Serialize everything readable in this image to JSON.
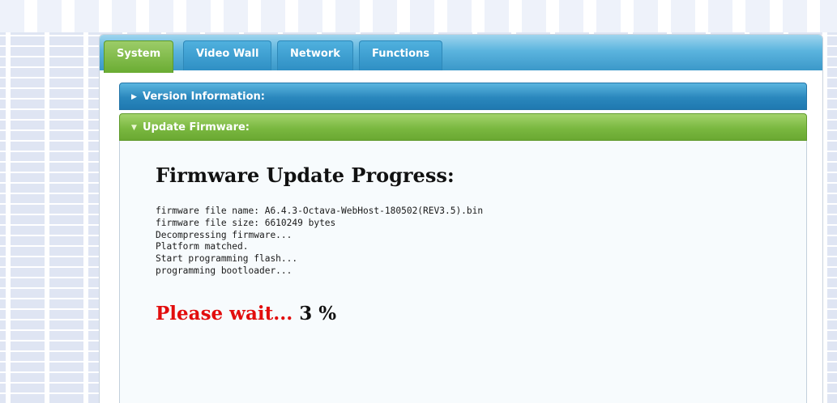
{
  "tabs": [
    {
      "label": "System",
      "active": true
    },
    {
      "label": "Video Wall",
      "active": false
    },
    {
      "label": "Network",
      "active": false
    },
    {
      "label": "Functions",
      "active": false
    }
  ],
  "sections": {
    "version_info": {
      "label": "Version Information:",
      "expanded": false,
      "icon": "caret-right-icon"
    },
    "update_firmware": {
      "label": "Update Firmware:",
      "expanded": true,
      "icon": "caret-down-icon"
    }
  },
  "firmware": {
    "heading": "Firmware Update Progress:",
    "log": [
      "firmware file name: A6.4.3-Octava-WebHost-180502(REV3.5).bin",
      "firmware file size: 6610249 bytes",
      "Decompressing firmware...",
      "Platform matched.",
      "Start programming flash...",
      "programming bootloader..."
    ],
    "wait_text": "Please wait...",
    "progress": "3 %"
  },
  "colors": {
    "tab_active": "#7ab840",
    "tab_inactive": "#3b98c9",
    "wait_text": "#e20d0d"
  }
}
